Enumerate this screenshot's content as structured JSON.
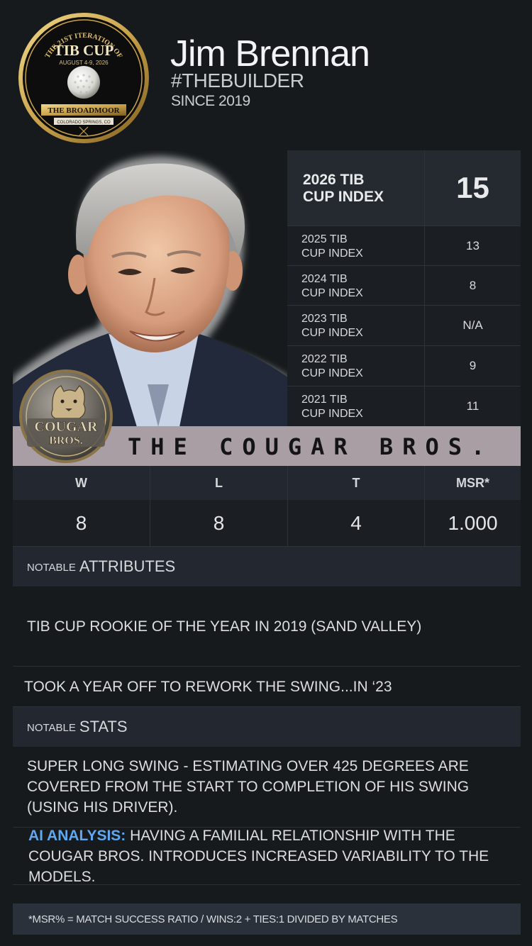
{
  "badge": {
    "arc_text": "THE 21ST ITERATION OF",
    "title": "TIB CUP",
    "dates": "AUGUST 4-9, 2026",
    "venue": "THE BROADMOOR",
    "location": "COLORADO SPRINGS, CO"
  },
  "player": {
    "name": "Jim Brennan",
    "nickname": "#THEBUILDER",
    "since": "SINCE 2019"
  },
  "index": {
    "current": {
      "label_line1": "2026 TIB",
      "label_line2": "CUP INDEX",
      "value": "15"
    },
    "history": [
      {
        "label_line1": "2025 TIB",
        "label_line2": "CUP INDEX",
        "value": "13"
      },
      {
        "label_line1": "2024 TIB",
        "label_line2": "CUP INDEX",
        "value": "8"
      },
      {
        "label_line1": "2023 TIB",
        "label_line2": "CUP INDEX",
        "value": "N/A"
      },
      {
        "label_line1": "2022 TIB",
        "label_line2": "CUP INDEX",
        "value": "9"
      },
      {
        "label_line1": "2021 TIB",
        "label_line2": "CUP INDEX",
        "value": "11"
      }
    ]
  },
  "team": {
    "name": "THE COUGAR BROS.",
    "logo_line1": "COUGAR",
    "logo_line2": "BROS."
  },
  "record": {
    "headers": [
      "W",
      "L",
      "T",
      "MSR*"
    ],
    "values": [
      "8",
      "8",
      "4",
      "1.000"
    ]
  },
  "attributes": {
    "prefix": "NOTABLE",
    "title": "ATTRIBUTES",
    "items": [
      "TIB CUP ROOKIE OF THE YEAR IN 2019 (SAND VALLEY)",
      "TOOK A YEAR OFF TO REWORK THE SWING...IN ‘23"
    ]
  },
  "stats": {
    "prefix": "NOTABLE",
    "title": "STATS",
    "items": [
      "SUPER LONG SWING - ESTIMATING OVER 425 DEGREES ARE COVERED FROM THE START TO COMPLETION OF HIS SWING (USING HIS DRIVER)."
    ],
    "ai_label": "AI ANALYSIS:",
    "ai_text": " HAVING A FAMILIAL RELATIONSHIP WITH THE COUGAR BROS. INTRODUCES INCREASED VARIABILITY TO THE MODELS."
  },
  "footnote": "*MSR% = MATCH SUCCESS RATIO / WINS:2 + TIES:1 DIVIDED BY MATCHES",
  "colors": {
    "background": "#161a1c",
    "banner": "#a99ea3",
    "header_cell": "#232830",
    "ai_accent": "#5fa8f0",
    "badge_gold": "#c9a24a"
  },
  "icons": [
    "tib-cup-badge-icon",
    "golf-ball-icon",
    "cougar-bros-logo-icon",
    "player-photo"
  ]
}
